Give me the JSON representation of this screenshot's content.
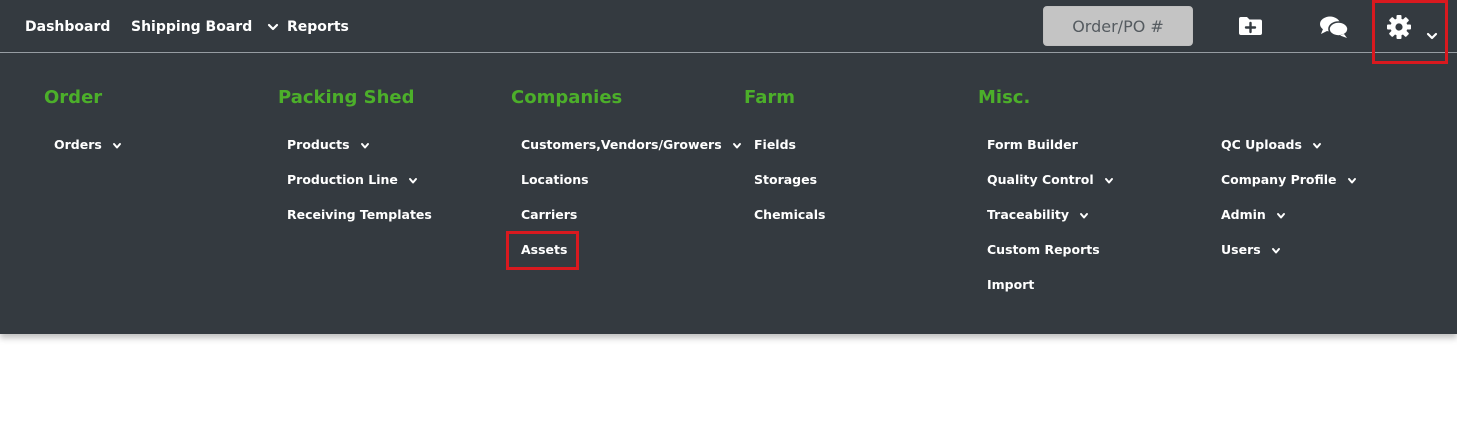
{
  "topnav": {
    "dashboard": "Dashboard",
    "shipping_board": "Shipping Board",
    "reports": "Reports",
    "search_placeholder": "Order/PO #"
  },
  "icons": {
    "add_folder": "folder-plus-icon",
    "chat": "comments-icon",
    "settings": "gear-icon",
    "dropdown": "chevron-down-icon"
  },
  "colors": {
    "nav_bg": "#343a40",
    "heading_green": "#4caf2a",
    "highlight_red": "#d9191f"
  },
  "menu": {
    "order": {
      "heading": "Order",
      "items": [
        "Orders"
      ]
    },
    "packing_shed": {
      "heading": "Packing Shed",
      "items": [
        "Products",
        "Production Line",
        "Receiving Templates"
      ]
    },
    "companies": {
      "heading": "Companies",
      "items": [
        "Customers,Vendors/Growers",
        "Locations",
        "Carriers",
        "Assets"
      ]
    },
    "farm": {
      "heading": "Farm",
      "items": [
        "Fields",
        "Storages",
        "Chemicals"
      ]
    },
    "misc": {
      "heading": "Misc.",
      "items": [
        "Form Builder",
        "Quality Control",
        "Traceability",
        "Custom Reports",
        "Import"
      ],
      "items_right": [
        "QC Uploads",
        "Company Profile",
        "Admin",
        "Users"
      ]
    }
  }
}
